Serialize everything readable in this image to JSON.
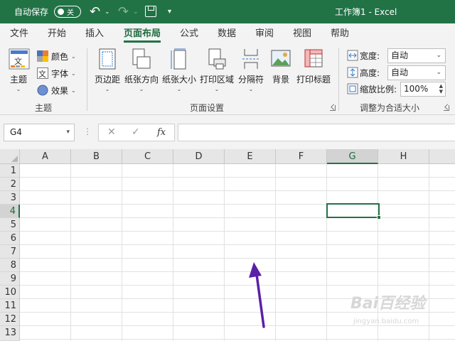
{
  "titlebar": {
    "autosave_label": "自动保存",
    "autosave_state": "关",
    "title": "工作簿1  -  Excel",
    "background": "#217346"
  },
  "tabs": [
    "文件",
    "开始",
    "插入",
    "页面布局",
    "公式",
    "数据",
    "审阅",
    "视图",
    "帮助"
  ],
  "active_tab": "页面布局",
  "ribbon": {
    "theme_group": {
      "label": "主题",
      "theme_button": "主题",
      "colors": "颜色",
      "fonts": "字体",
      "effects": "效果"
    },
    "page_setup_group": {
      "label": "页面设置",
      "margins": "页边距",
      "orientation": "纸张方向",
      "size": "纸张大小",
      "print_area": "打印区域",
      "breaks": "分隔符",
      "background": "背景",
      "print_titles": "打印标题"
    },
    "scale_group": {
      "label": "调整为合适大小",
      "width_label": "宽度:",
      "width_value": "自动",
      "height_label": "高度:",
      "height_value": "自动",
      "scale_label": "缩放比例:",
      "scale_value": "100%"
    }
  },
  "formula_bar": {
    "name_box": "G4",
    "cancel_icon": "✕",
    "enter_icon": "✓",
    "fx_label": "fx",
    "formula": ""
  },
  "grid": {
    "columns": [
      "A",
      "B",
      "C",
      "D",
      "E",
      "F",
      "G",
      "H"
    ],
    "rows": [
      "1",
      "2",
      "3",
      "4",
      "5",
      "6",
      "7",
      "8",
      "9",
      "10",
      "11",
      "12",
      "13"
    ],
    "selected_column": "G",
    "selected_row": "4",
    "accent": "#217346"
  },
  "annotation": {
    "arrow_color": "#5b1fa8"
  },
  "watermark": {
    "main": "Bai百经验",
    "sub": "jingyan.baidu.com"
  }
}
